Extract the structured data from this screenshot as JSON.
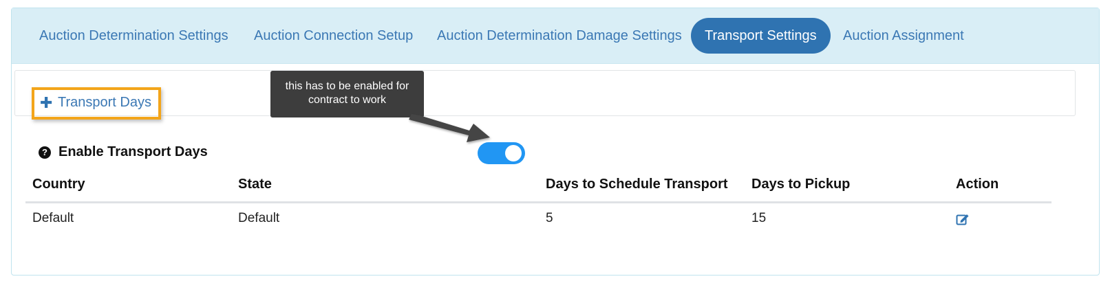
{
  "tabs": [
    {
      "label": "Auction Determination Settings",
      "active": false
    },
    {
      "label": "Auction Connection Setup",
      "active": false
    },
    {
      "label": "Auction Determination Damage Settings",
      "active": false
    },
    {
      "label": "Transport Settings",
      "active": true
    },
    {
      "label": "Auction Assignment",
      "active": false
    }
  ],
  "section": {
    "add_label": "Transport Days",
    "add_icon": "plus-icon"
  },
  "callout": {
    "line1": "this has to be enabled for",
    "line2": "contract to work"
  },
  "enable": {
    "label": "Enable Transport Days",
    "help_icon": "question-circle-icon",
    "enabled": true
  },
  "table": {
    "columns": [
      "Country",
      "State",
      "Days to Schedule Transport",
      "Days to Pickup",
      "Action"
    ],
    "rows": [
      {
        "country": "Default",
        "state": "Default",
        "days_schedule": "5",
        "days_pickup": "15",
        "action_icon": "edit-icon"
      }
    ]
  },
  "colors": {
    "accent": "#2f73b1",
    "tabbar_bg": "#d9eef6",
    "toggle_on": "#2196f3",
    "highlight": "#f3a51a",
    "callout_bg": "#3d3d3d"
  }
}
